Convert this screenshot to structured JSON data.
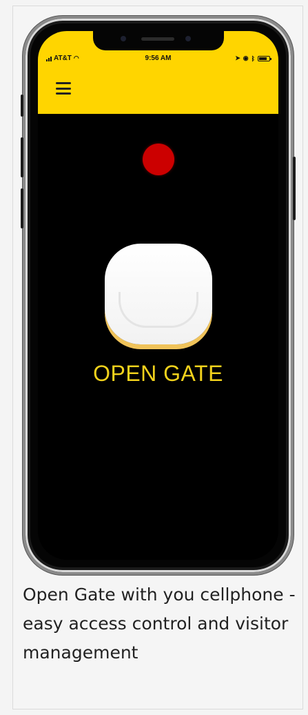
{
  "status_bar": {
    "carrier": "AT&T",
    "time": "9:56 AM",
    "wifi_icon": "wifi-icon",
    "location_icon": "location-arrow-icon",
    "alarm_icon": "alarm-icon",
    "bluetooth_icon": "bluetooth-icon",
    "battery_icon": "battery-icon",
    "battery_level": 0.8
  },
  "header": {
    "menu_icon": "hamburger-menu-icon",
    "background_color": "#ffd500"
  },
  "main": {
    "status_indicator_color": "#cc0000",
    "gate_button_icon": "gate-button-icon",
    "gate_label": "OPEN GATE",
    "label_color": "#f2d21c"
  },
  "caption": {
    "text": "Open Gate with you cellphone - easy access control and visitor management"
  }
}
